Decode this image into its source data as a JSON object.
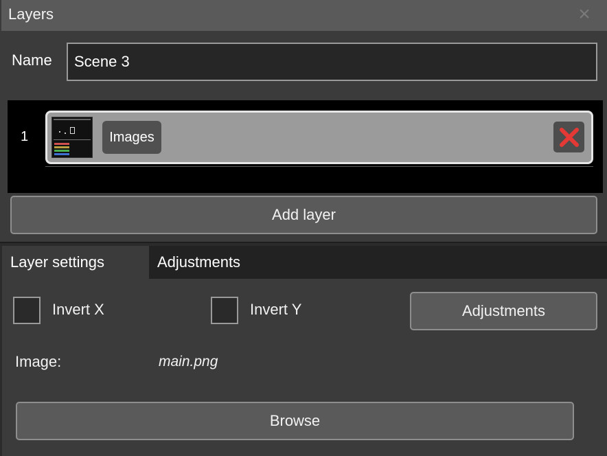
{
  "panel": {
    "title": "Layers",
    "close_icon": "close-icon"
  },
  "name_field": {
    "label": "Name",
    "value": "Scene 3"
  },
  "layers": [
    {
      "index": "1",
      "tag": "Images",
      "thumbnail_icon": "layer-thumbnail",
      "delete_icon": "x-icon"
    }
  ],
  "actions": {
    "add_layer": "Add layer"
  },
  "tabs": [
    {
      "label": "Layer settings",
      "active": true
    },
    {
      "label": "Adjustments",
      "active": false
    }
  ],
  "settings": {
    "invert_x": {
      "label": "Invert X",
      "checked": false
    },
    "invert_y": {
      "label": "Invert Y",
      "checked": false
    },
    "adjustments_button": "Adjustments",
    "image_label": "Image:",
    "image_value": "main.png",
    "browse_button": "Browse"
  },
  "colors": {
    "delete_accent": "#e53935",
    "panel_bg": "#3b3b3b",
    "titlebar_bg": "#5a5a5a"
  }
}
